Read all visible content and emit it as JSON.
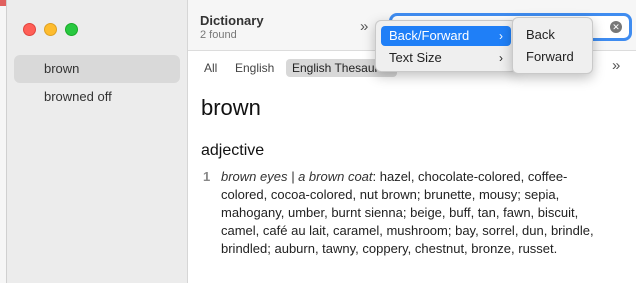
{
  "sidebar": {
    "items": [
      {
        "label": "brown",
        "selected": true
      },
      {
        "label": "browned off",
        "selected": false
      }
    ]
  },
  "header": {
    "title": "Dictionary",
    "subtitle": "2 found"
  },
  "tabs": [
    {
      "label": "All",
      "selected": false
    },
    {
      "label": "English",
      "selected": false
    },
    {
      "label": "English Thesaurus",
      "selected": true
    }
  ],
  "entry": {
    "headword": "brown",
    "part_of_speech": "adjective",
    "sense_number": "1",
    "example": "brown eyes | a brown coat",
    "synonyms": ": hazel, chocolate-colored, coffee-colored, cocoa-colored, nut brown; brunette, mousy; sepia, mahogany, umber, burnt sienna; beige, buff, tan, fawn, biscuit, camel, café au lait, caramel, mushroom; bay, sorrel, dun, brindle, brindled; auburn, tawny, coppery, chestnut, bronze, russet."
  },
  "context_menu": {
    "items": [
      {
        "label": "Back/Forward",
        "has_submenu": true,
        "active": true
      },
      {
        "label": "Text Size",
        "has_submenu": true,
        "active": false
      }
    ]
  },
  "submenu": {
    "items": [
      {
        "label": "Back"
      },
      {
        "label": "Forward"
      }
    ]
  },
  "icons": {
    "more_header": "double-chevron-right-icon",
    "more_tabs": "double-chevron-right-icon",
    "clear": "clear-search-icon"
  },
  "colors": {
    "accent": "#1f7ff7",
    "focus_ring": "#3f8cf0"
  }
}
